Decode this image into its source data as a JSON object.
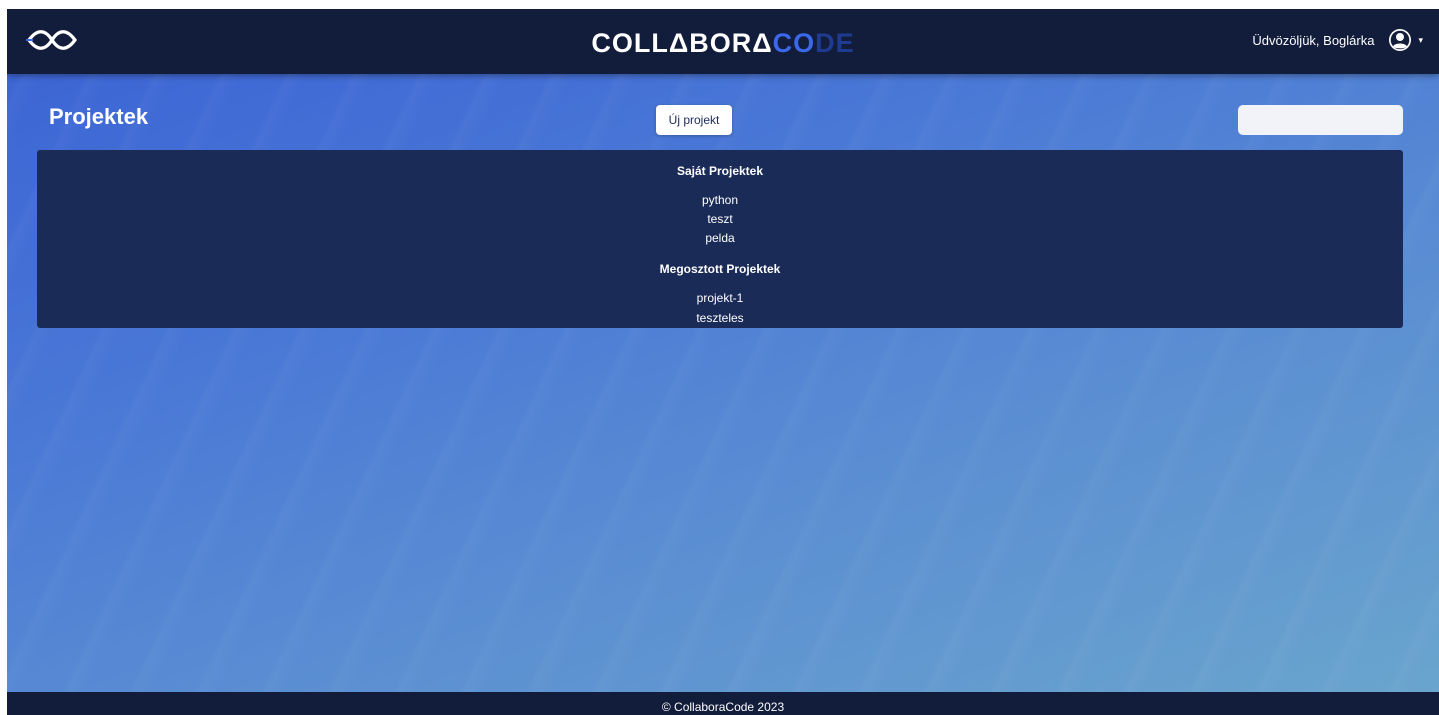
{
  "navbar": {
    "logo_icon": "infinity-logo-icon",
    "brand": {
      "part1": "COLLΔBORΔ",
      "part2": "CO",
      "part3": "DE"
    },
    "greeting": "Üdvözöljük, Boglárka",
    "avatar_icon": "user-circle-icon",
    "caret_icon": "chevron-down-icon"
  },
  "page": {
    "title": "Projektek",
    "new_project_label": "Új projekt",
    "search_value": ""
  },
  "projects": {
    "own_title": "Saját Projektek",
    "own": [
      "python",
      "teszt",
      "pelda"
    ],
    "shared_title": "Megosztott Projektek",
    "shared": [
      "projekt-1",
      "teszteles"
    ]
  },
  "footer": {
    "text": "© CollaboraCode 2023"
  },
  "colors": {
    "navbar": "#121c3b",
    "panel": "#1b2b57",
    "brand_accent": "#3a68e8"
  }
}
